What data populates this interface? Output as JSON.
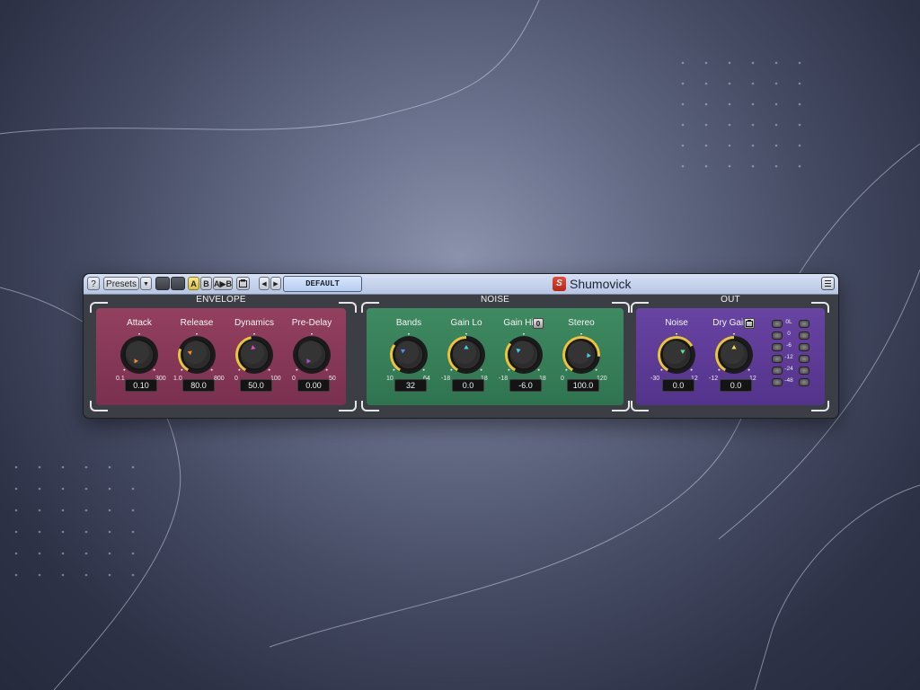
{
  "toolbar": {
    "help_label": "?",
    "presets_label": "Presets",
    "dropdown_arrow": "▼",
    "a_label": "A",
    "b_label": "B",
    "a_to_b_label": "A▶B",
    "prev_arrow": "◀",
    "next_arrow": "▶",
    "preset_name": "DEFAULT",
    "brand_logo": "S",
    "brand_name": "Shumovick"
  },
  "sections": {
    "envelope_title": "ENVELOPE",
    "noise_title": "NOISE",
    "out_title": "OUT"
  },
  "envelope": {
    "attack": {
      "label": "Attack",
      "value": "0.10",
      "min": "0.1",
      "max": "300",
      "pointer_color": "#f08a2a"
    },
    "release": {
      "label": "Release",
      "value": "80.0",
      "min": "1.0",
      "max": "800",
      "pointer_color": "#f08a2a"
    },
    "dynamics": {
      "label": "Dynamics",
      "value": "50.0",
      "min": "0",
      "max": "100",
      "pointer_color": "#e24bd1"
    },
    "predelay": {
      "label": "Pre-Delay",
      "value": "0.00",
      "min": "0",
      "max": "50",
      "pointer_color": "#b44be0"
    }
  },
  "noise": {
    "bands": {
      "label": "Bands",
      "value": "32",
      "min": "10",
      "max": "64",
      "pointer_color": "#5b8cf2"
    },
    "gain_lo": {
      "label": "Gain Lo",
      "value": "0.0",
      "min": "-18",
      "max": "18",
      "pointer_color": "#3fd2e6"
    },
    "gain_hi": {
      "label": "Gain Hi",
      "value": "-6.0",
      "min": "-18",
      "max": "18",
      "pointer_color": "#3fd2e6",
      "button": "0"
    },
    "stereo": {
      "label": "Stereo",
      "value": "100.0",
      "min": "0",
      "max": "120",
      "pointer_color": "#3fd2e6"
    }
  },
  "out": {
    "noise": {
      "label": "Noise",
      "value": "0.0",
      "min": "-30",
      "max": "12",
      "pointer_color": "#5de39a"
    },
    "dry_gain": {
      "label": "Dry Gain",
      "value": "0.0",
      "min": "-12",
      "max": "12",
      "pointer_color": "#f0e04a"
    },
    "meter_labels": [
      "0L",
      "0",
      "-6",
      "-12",
      "-24",
      "-48"
    ]
  },
  "colors": {
    "envelope_panel": "#8a3858",
    "noise_panel": "#37805a",
    "out_panel": "#5e3c97",
    "knob_arc": "#e8c53a"
  }
}
